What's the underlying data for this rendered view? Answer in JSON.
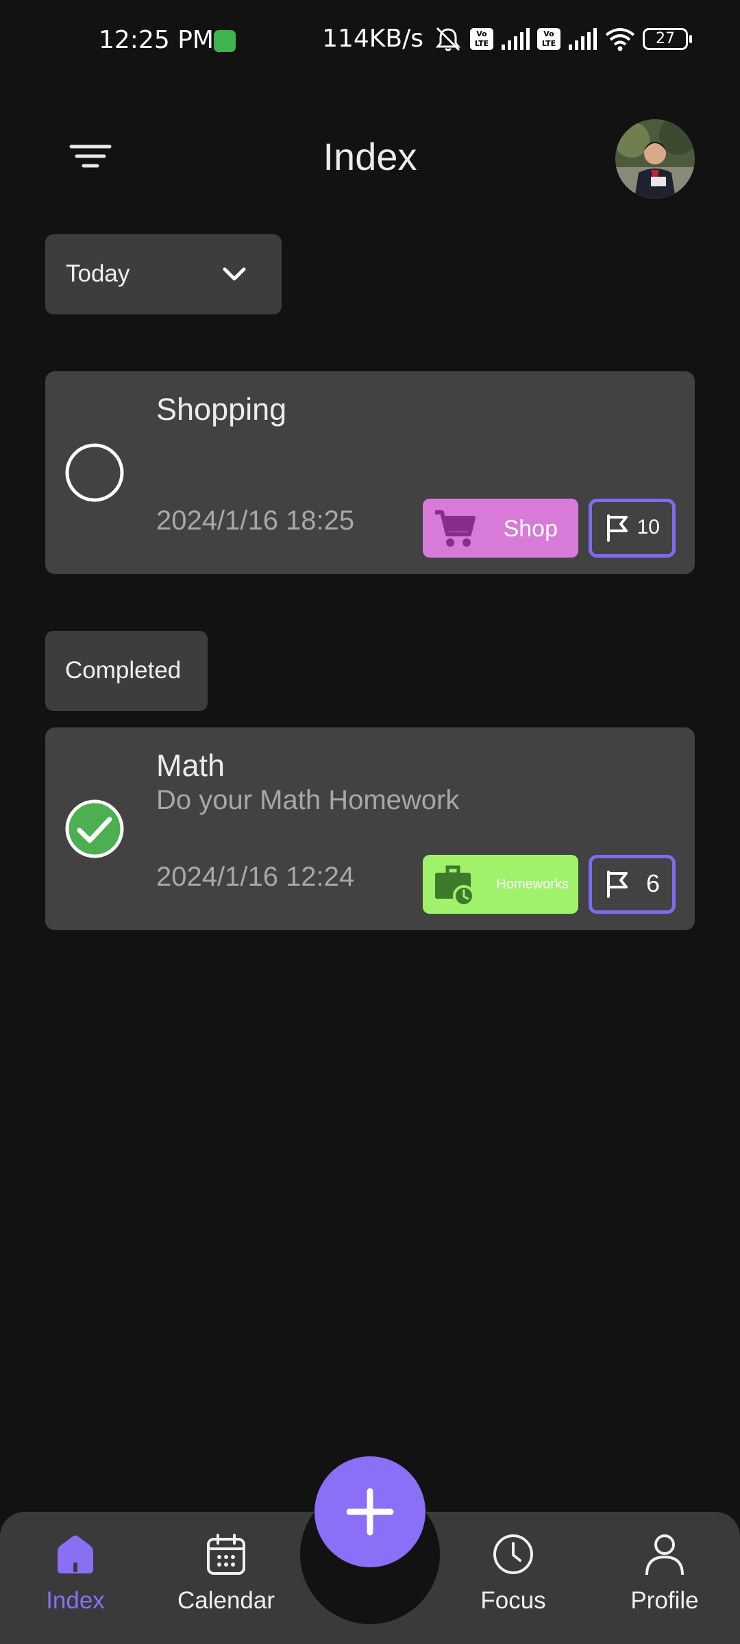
{
  "status_bar": {
    "time": "12:25 PM",
    "net_speed": "114KB/s",
    "volte1": "Vo LTE",
    "volte2": "Vo LTE",
    "battery": "27"
  },
  "header": {
    "title": "Index",
    "filter_icon": "filter-lines-icon",
    "avatar_alt": "user avatar"
  },
  "filter": {
    "selected": "Today"
  },
  "tasks": [
    {
      "title": "Shopping",
      "description": "",
      "datetime": "2024/1/16 18:25",
      "completed": false,
      "category": {
        "label": "Shop",
        "icon": "cart-icon",
        "color": "#d77ad8"
      },
      "priority": "10"
    }
  ],
  "completed_section": {
    "label": "Completed",
    "tasks": [
      {
        "title": "Math",
        "description": "Do your Math Homework",
        "datetime": "2024/1/16 12:24",
        "completed": true,
        "category": {
          "label": "Homeworks",
          "icon": "briefcase-clock-icon",
          "color": "#a0f26a"
        },
        "priority": "6"
      }
    ]
  },
  "bottom_nav": {
    "items": [
      {
        "label": "Index",
        "icon": "home-icon",
        "active": true
      },
      {
        "label": "Calendar",
        "icon": "calendar-icon",
        "active": false
      },
      {
        "label": "Focus",
        "icon": "clock-icon",
        "active": false
      },
      {
        "label": "Profile",
        "icon": "person-icon",
        "active": false
      }
    ],
    "fab_icon": "plus-icon"
  },
  "colors": {
    "accent": "#8b6ff6",
    "background": "#121212",
    "card": "#424242",
    "success": "#4caf50",
    "priority_border": "#7c6cf0"
  }
}
